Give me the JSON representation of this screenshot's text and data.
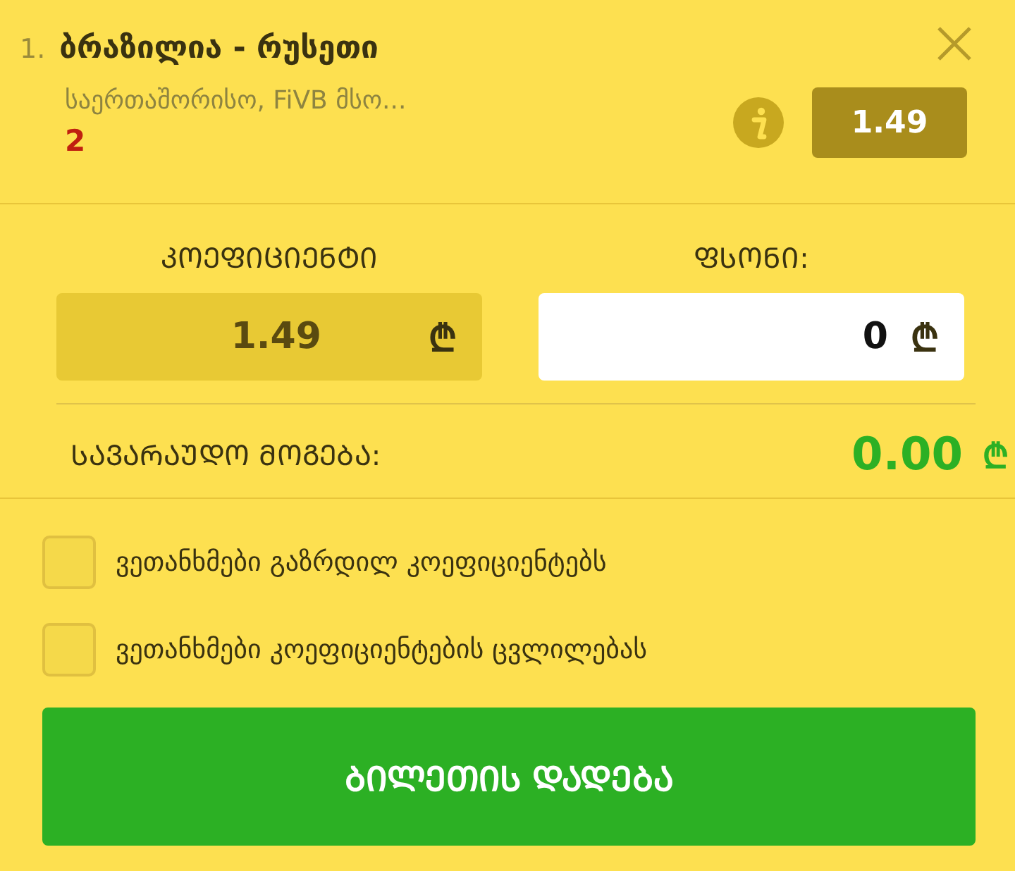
{
  "bet": {
    "index": "1.",
    "title": "ბრაზილია - რუსეთი",
    "league": "საერთაშორისო, FiVB მსო...",
    "pick": "2",
    "odds": "1.49"
  },
  "stake_panel": {
    "odds_label": "ᲙᲝᲔᲤᲘᲪᲘᲔᲜᲢᲘ",
    "odds_value": "1.49",
    "odds_currency": "₾",
    "stake_label": "ᲤᲡᲝᲜᲘ:",
    "stake_value": "0",
    "stake_currency": "₾"
  },
  "winnings": {
    "label": "ᲡᲐᲕᲐᲠᲐᲣᲓᲝ ᲛᲝᲒᲔᲑᲐ:",
    "value": "0.00",
    "currency": "₾"
  },
  "options": [
    {
      "label": "ვეთანხმები გაზრდილ კოეფიციენტებს",
      "checked": false
    },
    {
      "label": "ვეთანხმები კოეფიციენტების ცვლილებას",
      "checked": false
    }
  ],
  "submit": {
    "label": "ᲑᲘᲚᲔᲗᲘᲡ ᲓᲐᲓᲔᲑᲐ"
  }
}
